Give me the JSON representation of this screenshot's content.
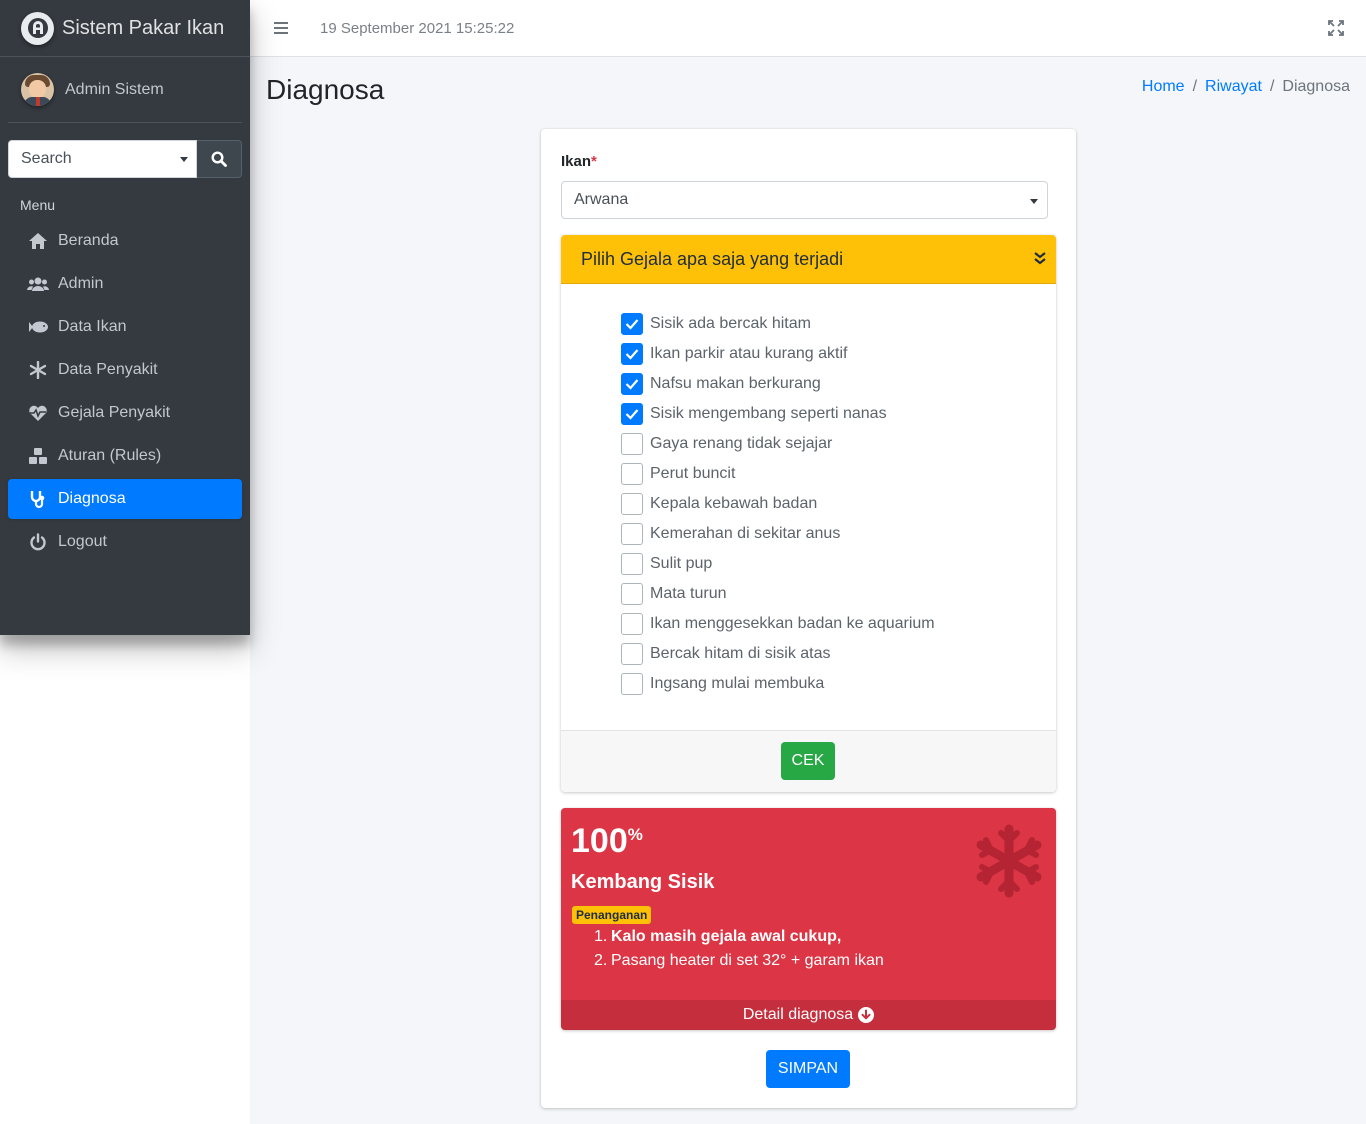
{
  "brand": {
    "name": "Sistem Pakar Ikan",
    "logo_icon": "brand-logo-icon"
  },
  "user": {
    "name": "Admin Sistem"
  },
  "sidebar": {
    "search_placeholder": "Search",
    "menu_header": "Menu",
    "items": [
      {
        "label": "Beranda",
        "icon": "home-icon",
        "active": false
      },
      {
        "label": "Admin",
        "icon": "users-icon",
        "active": false
      },
      {
        "label": "Data Ikan",
        "icon": "fish-icon",
        "active": false
      },
      {
        "label": "Data Penyakit",
        "icon": "snowflake-icon",
        "active": false
      },
      {
        "label": "Gejala Penyakit",
        "icon": "heartbeat-icon",
        "active": false
      },
      {
        "label": "Aturan (Rules)",
        "icon": "cubes-icon",
        "active": false
      },
      {
        "label": "Diagnosa",
        "icon": "stethoscope-icon",
        "active": true
      },
      {
        "label": "Logout",
        "icon": "power-icon",
        "active": false
      }
    ]
  },
  "topbar": {
    "datetime": "19 September 2021 15:25:22"
  },
  "page": {
    "title": "Diagnosa",
    "breadcrumb": [
      "Home",
      "Riwayat",
      "Diagnosa"
    ]
  },
  "form": {
    "ikan_label": "Ikan",
    "required_mark": "*",
    "ikan_value": "Arwana",
    "gejala_header": "Pilih Gejala apa saja yang terjadi",
    "gejala": [
      {
        "label": "Sisik ada bercak hitam",
        "checked": true
      },
      {
        "label": "Ikan parkir atau kurang aktif",
        "checked": true
      },
      {
        "label": "Nafsu makan berkurang",
        "checked": true
      },
      {
        "label": "Sisik mengembang seperti nanas",
        "checked": true
      },
      {
        "label": "Gaya renang tidak sejajar",
        "checked": false
      },
      {
        "label": "Perut buncit",
        "checked": false
      },
      {
        "label": "Kepala kebawah badan",
        "checked": false
      },
      {
        "label": "Kemerahan di sekitar anus",
        "checked": false
      },
      {
        "label": "Sulit pup",
        "checked": false
      },
      {
        "label": "Mata turun",
        "checked": false
      },
      {
        "label": "Ikan menggesekkan badan ke aquarium",
        "checked": false
      },
      {
        "label": "Bercak hitam di sisik atas",
        "checked": false
      },
      {
        "label": "Ingsang mulai membuka",
        "checked": false
      }
    ],
    "cek_label": "CEK"
  },
  "result": {
    "percent": "100",
    "percent_sign": "%",
    "disease": "Kembang Sisik",
    "badge": "Penanganan",
    "steps": [
      {
        "num": "1.",
        "text": "Kalo masih gejala awal cukup,"
      },
      {
        "num": "2.",
        "text": "Pasang heater di set 32° + garam ikan"
      }
    ],
    "detail_label": "Detail diagnosa",
    "color": "#dc3545"
  },
  "simpan_label": "SIMPAN"
}
